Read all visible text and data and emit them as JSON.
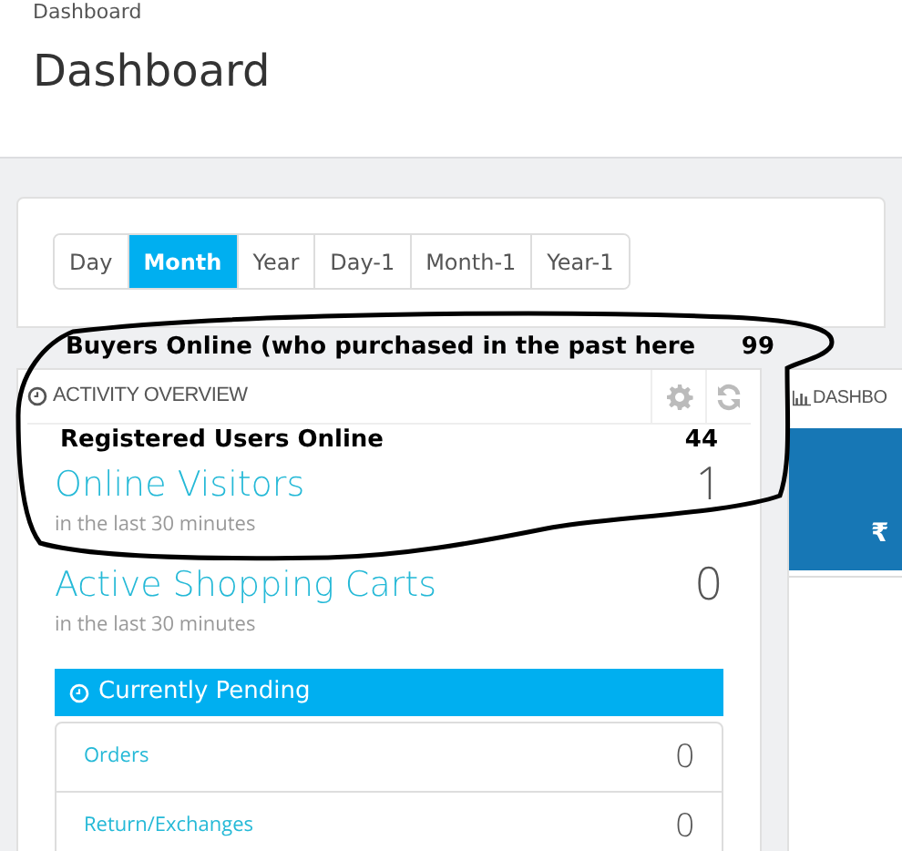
{
  "breadcrumb": "Dashboard",
  "page_title": "Dashboard",
  "period_tabs": [
    {
      "label": "Day",
      "selected": false
    },
    {
      "label": "Month",
      "selected": true
    },
    {
      "label": "Year",
      "selected": false
    },
    {
      "label": "Day-1",
      "selected": false
    },
    {
      "label": "Month-1",
      "selected": false
    },
    {
      "label": "Year-1",
      "selected": false
    }
  ],
  "annotation": {
    "label": "Buyers Online (who purchased in the past here",
    "value": "99"
  },
  "activity_overview": {
    "title": "ACTIVITY OVERVIEW",
    "registered_users": {
      "label": "Registered Users Online",
      "value": "44"
    },
    "metrics": [
      {
        "label": "Online Visitors",
        "value": "1",
        "caption": "in the last 30 minutes"
      },
      {
        "label": "Active Shopping Carts",
        "value": "0",
        "caption": "in the last 30 minutes"
      }
    ],
    "pending": {
      "title": "Currently Pending",
      "rows": [
        {
          "label": "Orders",
          "value": "0"
        },
        {
          "label": "Return/Exchanges",
          "value": "0"
        }
      ]
    }
  },
  "dashboard_panel": {
    "title": "DASHBO",
    "currency": "₹"
  }
}
